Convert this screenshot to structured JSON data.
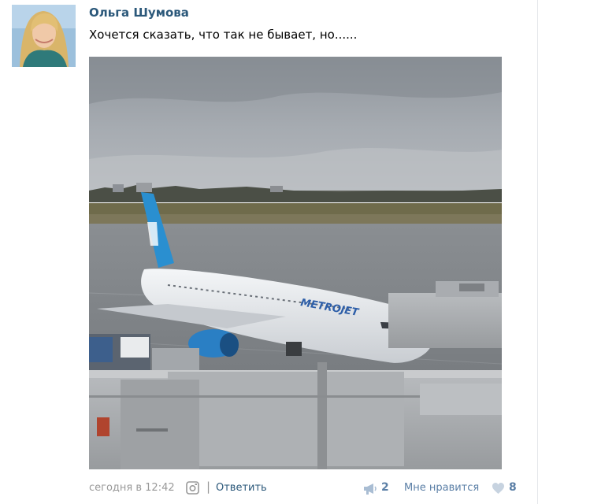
{
  "post": {
    "author": "Ольга Шумова",
    "text": "Хочется сказать, что так не бывает, но......",
    "photo_brand": "METROJET"
  },
  "footer": {
    "timestamp": "сегодня в 12:42",
    "separator": "|",
    "reply_label": "Ответить",
    "shares_count": "2",
    "like_label": "Мне нравится",
    "likes_count": "8"
  },
  "icons": {
    "source": "instagram-icon",
    "share": "megaphone-icon",
    "like": "heart-icon"
  },
  "colors": {
    "author_link": "#2b587a",
    "muted_text": "#999999",
    "action_blue": "#5b7fa6",
    "heart": "#c7d3e0"
  }
}
